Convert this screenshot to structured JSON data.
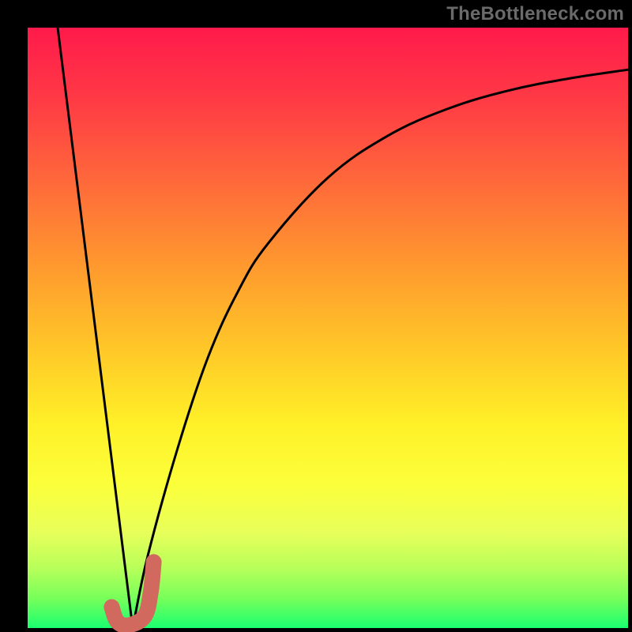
{
  "watermark": "TheBottleneck.com",
  "chart_data": {
    "type": "line",
    "title": "",
    "xlabel": "",
    "ylabel": "",
    "xlim": [
      0,
      100
    ],
    "ylim": [
      0,
      100
    ],
    "grid": false,
    "legend": false,
    "series": [
      {
        "name": "descending-line",
        "x": [
          5,
          17.5
        ],
        "values": [
          100,
          0
        ]
      },
      {
        "name": "rising-curve",
        "x": [
          17.5,
          20,
          25,
          30,
          35,
          40,
          50,
          60,
          70,
          80,
          90,
          100
        ],
        "values": [
          0,
          12,
          30,
          45,
          56,
          64,
          75,
          82,
          86.5,
          89.5,
          91.5,
          93
        ]
      },
      {
        "name": "accent-j",
        "x": [
          14,
          15,
          17,
          19.5,
          20.5,
          21
        ],
        "values": [
          3.5,
          1,
          0.5,
          2,
          6,
          11
        ]
      }
    ],
    "colors": {
      "background_top": "#ff1a4b",
      "background_bottom": "#1aff70",
      "curve": "#000000",
      "accent": "#d1695f"
    }
  }
}
